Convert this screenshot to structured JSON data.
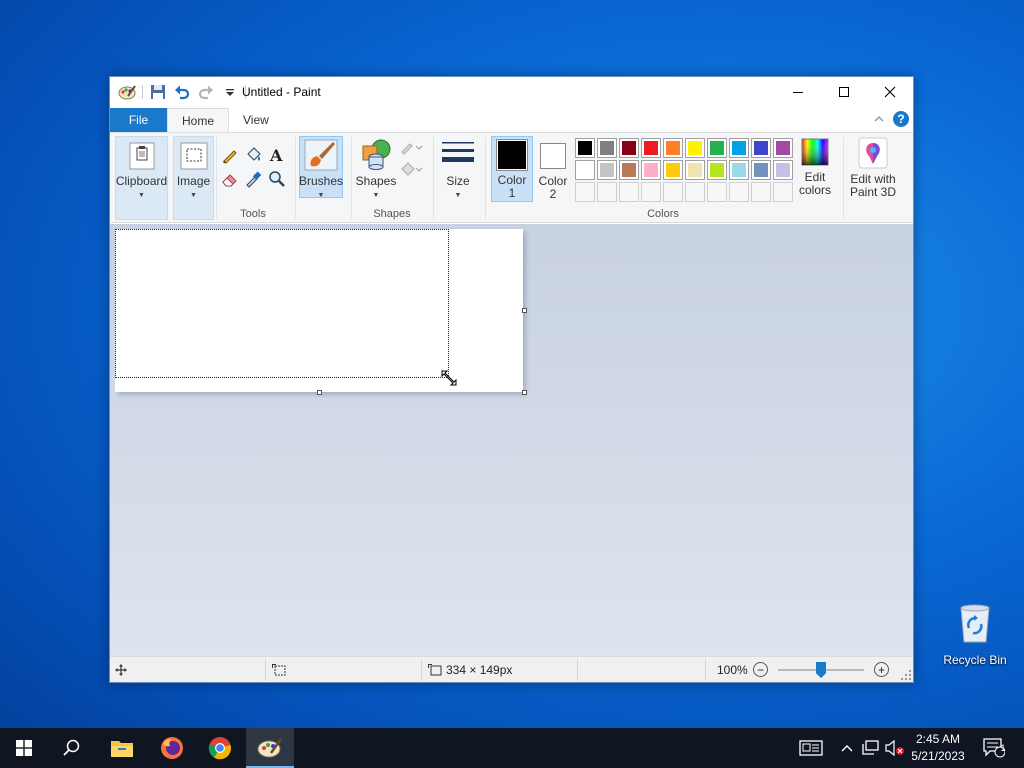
{
  "window": {
    "title": "Untitled - Paint"
  },
  "tabs": {
    "file": "File",
    "home": "Home",
    "view": "View",
    "help_glyph": "?"
  },
  "ribbon": {
    "clipboard": {
      "label": "Clipboard"
    },
    "image": {
      "label": "Image"
    },
    "tools": {
      "group_label": "Tools"
    },
    "brushes": {
      "label": "Brushes"
    },
    "shapes": {
      "label": "Shapes",
      "group_label": "Shapes"
    },
    "size": {
      "label": "Size"
    },
    "color1": {
      "line1": "Color",
      "line2": "1",
      "value": "#000000"
    },
    "color2": {
      "line1": "Color",
      "line2": "2",
      "value": "#ffffff"
    },
    "colors_group_label": "Colors",
    "edit_colors": {
      "line1": "Edit",
      "line2": "colors"
    },
    "edit_paint3d": {
      "line1": "Edit with",
      "line2": "Paint 3D"
    },
    "palette": [
      "#000000",
      "#7f7f7f",
      "#880015",
      "#ed1c24",
      "#ff7f27",
      "#fff200",
      "#22b14c",
      "#00a2e8",
      "#3f48cc",
      "#a349a4",
      "#ffffff",
      "#c3c3c3",
      "#b97a57",
      "#ffaec9",
      "#ffc90e",
      "#efe4b0",
      "#b5e61d",
      "#99d9ea",
      "#7092be",
      "#c8bfe7",
      "",
      "",
      "",
      "",
      "",
      "",
      "",
      "",
      "",
      ""
    ]
  },
  "status": {
    "dimensions": "334 × 149px",
    "zoom": "100%",
    "zoom_level_fraction": 0.5,
    "zoom_minus": "−",
    "zoom_plus": "+"
  },
  "desktop": {
    "recycle_bin": "Recycle Bin"
  },
  "taskbar": {
    "time": "2:45 AM",
    "date": "5/21/2023",
    "notification_count": "1"
  },
  "icons": [
    "paint-app-icon",
    "save-icon",
    "undo-icon",
    "redo-icon",
    "customize-qat-icon",
    "minimize-icon",
    "maximize-icon",
    "close-icon",
    "collapse-ribbon-icon",
    "help-icon",
    "clipboard-icon",
    "select-icon",
    "pencil-icon",
    "fill-icon",
    "text-icon",
    "eraser-icon",
    "color-picker-icon",
    "magnifier-icon",
    "brush-icon",
    "shapes-icon",
    "outline-icon",
    "fill-shape-icon",
    "size-icon",
    "edit-colors-icon",
    "paint3d-icon",
    "move-icon",
    "selection-size-icon",
    "canvas-size-icon",
    "start-icon",
    "search-icon",
    "file-explorer-icon",
    "firefox-icon",
    "chrome-icon",
    "paint-taskbar-icon",
    "news-icon",
    "chevron-up-icon",
    "network-icon",
    "volume-muted-icon",
    "notification-icon",
    "recycle-bin-icon"
  ]
}
